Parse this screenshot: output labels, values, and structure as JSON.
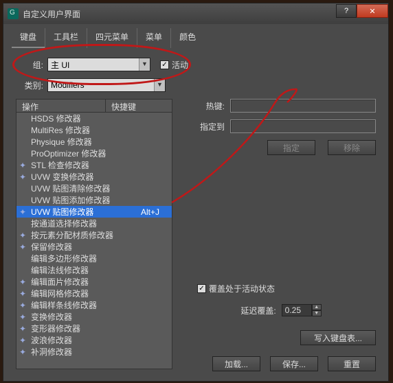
{
  "title": "自定义用户界面",
  "titlebar": {
    "help": "?",
    "close": "✕"
  },
  "tabs": [
    "键盘",
    "工具栏",
    "四元菜单",
    "菜单",
    "颜色"
  ],
  "group": {
    "label": "组:",
    "value": "主 UI"
  },
  "active_chk": {
    "label": "活动",
    "checked": true
  },
  "category": {
    "label": "类别:",
    "value": "Modifiers"
  },
  "list_headers": {
    "action": "操作",
    "hotkey": "快捷键"
  },
  "items": [
    {
      "icon": "",
      "label": "HSDS 修改器",
      "hk": ""
    },
    {
      "icon": "",
      "label": "MultiRes 修改器",
      "hk": ""
    },
    {
      "icon": "",
      "label": "Physique 修改器",
      "hk": ""
    },
    {
      "icon": "",
      "label": "ProOptimizer 修改器",
      "hk": ""
    },
    {
      "icon": "✦",
      "label": "STL 检查修改器",
      "hk": ""
    },
    {
      "icon": "✦",
      "label": "UVW 变换修改器",
      "hk": ""
    },
    {
      "icon": "",
      "label": "UVW 贴图清除修改器",
      "hk": ""
    },
    {
      "icon": "",
      "label": "UVW 贴图添加修改器",
      "hk": ""
    },
    {
      "icon": "✦",
      "label": "UVW 贴图修改器",
      "hk": "Alt+J",
      "sel": true
    },
    {
      "icon": "",
      "label": "按通道选择修改器",
      "hk": ""
    },
    {
      "icon": "✦",
      "label": "按元素分配材质修改器",
      "hk": ""
    },
    {
      "icon": "✦",
      "label": "保留修改器",
      "hk": ""
    },
    {
      "icon": "",
      "label": "编辑多边形修改器",
      "hk": ""
    },
    {
      "icon": "",
      "label": "编辑法线修改器",
      "hk": ""
    },
    {
      "icon": "✦",
      "label": "编辑面片修改器",
      "hk": ""
    },
    {
      "icon": "✦",
      "label": "编辑网格修改器",
      "hk": ""
    },
    {
      "icon": "✦",
      "label": "编辑样条线修改器",
      "hk": ""
    },
    {
      "icon": "✦",
      "label": "变换修改器",
      "hk": ""
    },
    {
      "icon": "✦",
      "label": "变形器修改器",
      "hk": ""
    },
    {
      "icon": "✦",
      "label": "波浪修改器",
      "hk": ""
    },
    {
      "icon": "✦",
      "label": "补洞修改器",
      "hk": ""
    }
  ],
  "hotkey": {
    "label": "热键:"
  },
  "assignto": {
    "label": "指定到"
  },
  "buttons": {
    "assign": "指定",
    "remove": "移除"
  },
  "override": {
    "label": "覆盖处于活动状态",
    "checked": true
  },
  "delay": {
    "label": "延迟覆盖:",
    "value": "0.25"
  },
  "write_btn": "写入键盘表...",
  "bottom": {
    "load": "加载...",
    "save": "保存...",
    "reset": "重置"
  }
}
